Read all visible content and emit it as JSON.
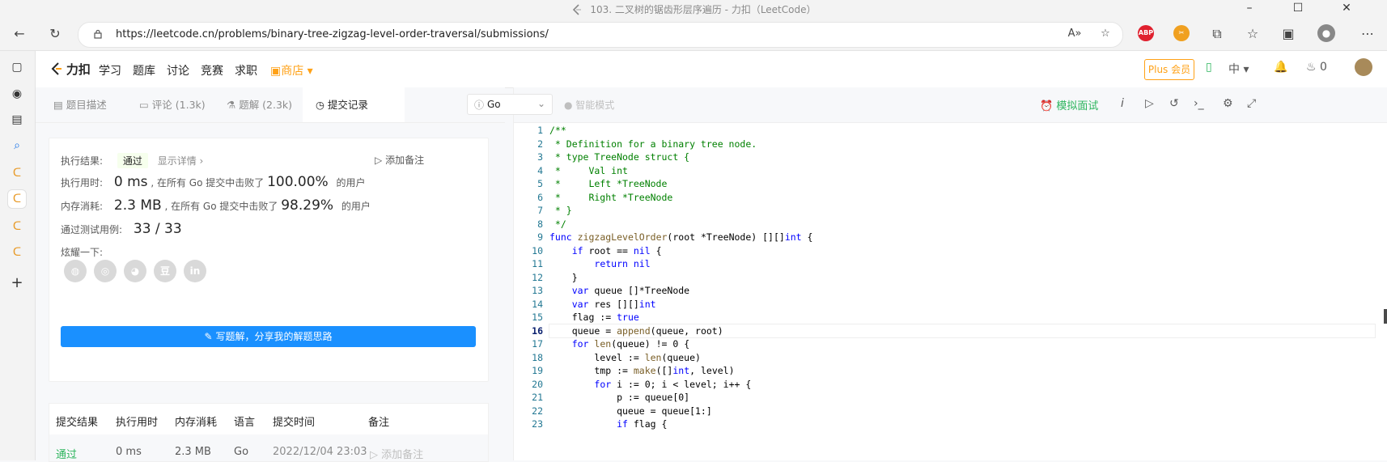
{
  "window": {
    "title": "103. 二叉树的锯齿形层序遍历 - 力扣（LeetCode）"
  },
  "browser": {
    "url": "https://leetcode.cn/problems/binary-tree-zigzag-level-order-traversal/submissions/",
    "ext_abp": "ABP",
    "icons": [
      "back-icon",
      "refresh-icon",
      "lock-icon",
      "read-aloud-icon",
      "add-favorite-icon",
      "abp-extension-icon",
      "extension-icon",
      "puzzle-icon",
      "favorites-icon",
      "collections-icon",
      "profile-icon",
      "more-icon"
    ]
  },
  "nav": {
    "logo": "力扣",
    "items": [
      "学习",
      "题库",
      "讨论",
      "竞赛",
      "求职"
    ],
    "store": "商店",
    "plus": "Plus 会员",
    "lang": "中",
    "streak": "0"
  },
  "tabs": [
    "题目描述",
    "评论 (1.3k)",
    "题解 (2.3k)",
    "提交记录"
  ],
  "result": {
    "exec_label": "执行结果:",
    "status": "通过",
    "details": "显示详情 ›",
    "add_note": "添加备注",
    "time_label": "执行用时:",
    "time_value": "0 ms",
    "time_mid": ", 在所有 Go 提交中击败了",
    "time_pct": "100.00%",
    "time_end": "的用户",
    "mem_label": "内存消耗:",
    "mem_value": "2.3 MB",
    "mem_mid": ", 在所有 Go 提交中击败了",
    "mem_pct": "98.29%",
    "mem_end": "的用户",
    "cases_label": "通过测试用例:",
    "cases_value": "33 / 33",
    "share_label": "炫耀一下:",
    "write_btn": "写题解，分享我的解题思路"
  },
  "table": {
    "headers": [
      "提交结果",
      "执行用时",
      "内存消耗",
      "语言",
      "提交时间",
      "备注"
    ],
    "row": [
      "通过",
      "0 ms",
      "2.3 MB",
      "Go",
      "2022/12/04 23:03",
      "添加备注"
    ]
  },
  "editor": {
    "language": "Go",
    "smart_mode": "智能模式",
    "mock_interview": "模拟面试",
    "current_line": 16,
    "lines": [
      "/**",
      " * Definition for a binary tree node.",
      " * type TreeNode struct {",
      " *     Val int",
      " *     Left *TreeNode",
      " *     Right *TreeNode",
      " * }",
      " */",
      "func zigzagLevelOrder(root *TreeNode) [][]int {",
      "    if root == nil {",
      "        return nil",
      "    }",
      "    var queue []*TreeNode",
      "    var res [][]int",
      "    flag := true",
      "    queue = append(queue, root)",
      "    for len(queue) != 0 {",
      "        level := len(queue)",
      "        tmp := make([]int, level)",
      "        for i := 0; i < level; i++ {",
      "            p := queue[0]",
      "            queue = queue[1:]",
      "            if flag {"
    ]
  }
}
